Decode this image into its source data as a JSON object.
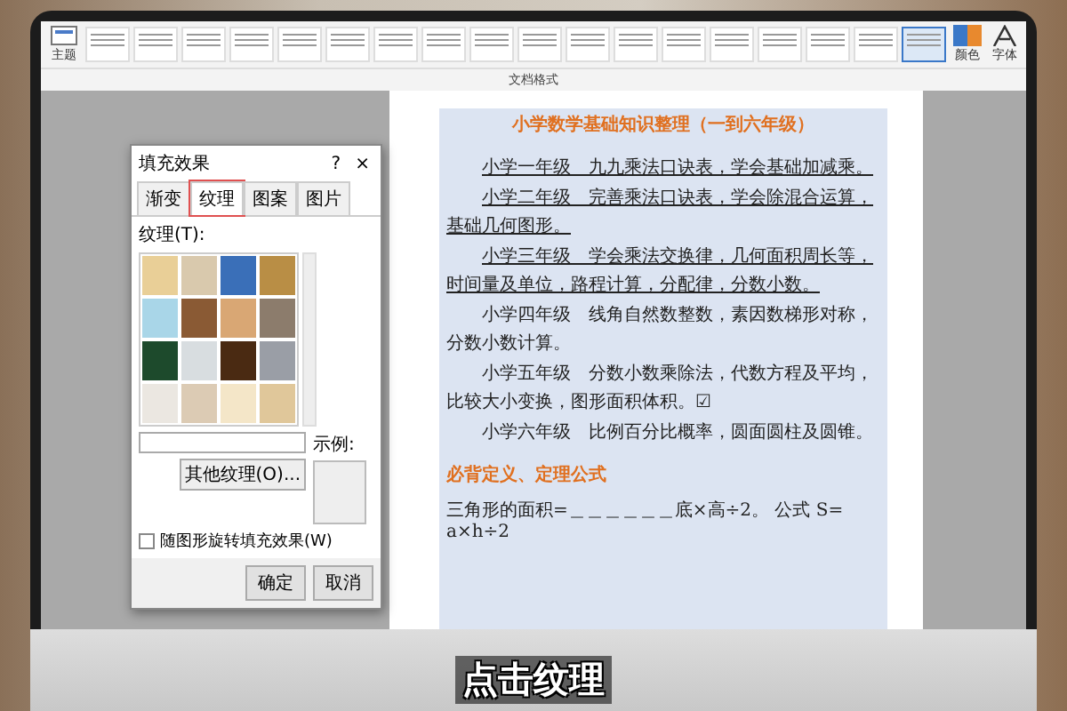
{
  "ribbon": {
    "theme_button": "主题",
    "styles": [
      {
        "selected": false
      },
      {
        "selected": false
      },
      {
        "selected": false
      },
      {
        "selected": false
      },
      {
        "selected": false
      },
      {
        "selected": false
      },
      {
        "selected": false
      },
      {
        "selected": false
      },
      {
        "selected": false
      },
      {
        "selected": false
      },
      {
        "selected": false
      },
      {
        "selected": false
      },
      {
        "selected": false
      },
      {
        "selected": false
      },
      {
        "selected": false
      },
      {
        "selected": false
      },
      {
        "selected": false
      },
      {
        "selected": true
      }
    ],
    "colors_button": "颜色",
    "fonts_button": "字体",
    "group_label": "文档格式"
  },
  "dialog": {
    "title": "填充效果",
    "help": "?",
    "close": "×",
    "tabs": [
      {
        "label": "渐变",
        "selected": false
      },
      {
        "label": "纹理",
        "selected": true
      },
      {
        "label": "图案",
        "selected": false
      },
      {
        "label": "图片",
        "selected": false
      }
    ],
    "texture_label": "纹理(T):",
    "textures": [
      {
        "color": "#e9cf97"
      },
      {
        "color": "#d9c9ad"
      },
      {
        "color": "#3a6fb8"
      },
      {
        "color": "#b98e45"
      },
      {
        "color": "#a9d6e8"
      },
      {
        "color": "#8a5a34"
      },
      {
        "color": "#d9a774"
      },
      {
        "color": "#8c7c6c"
      },
      {
        "color": "#1d4a2c"
      },
      {
        "color": "#d8dde0"
      },
      {
        "color": "#4a2a12"
      },
      {
        "color": "#9a9ea6"
      },
      {
        "color": "#ebe7e1"
      },
      {
        "color": "#dccbb4"
      },
      {
        "color": "#f4e6c8"
      },
      {
        "color": "#e0c79a"
      }
    ],
    "more_button": "其他纹理(O)...",
    "preview_label": "示例:",
    "rotate_option": {
      "label": "随图形旋转填充效果(W)",
      "checked": false
    },
    "buttons": [
      "确定",
      "取消"
    ]
  },
  "document": {
    "title": "小学数学基础知识整理（一到六年级）",
    "paragraphs": [
      {
        "text": "小学一年级　九九乘法口诀表，学会基础加减乘。",
        "underlined": true
      },
      {
        "text": "小学二年级　完善乘法口诀表，学会除混合运算，基础几何图形。",
        "underlined": true
      },
      {
        "text": "小学三年级　学会乘法交换律，几何面积周长等，时间量及单位，路程计算，分配律，分数小数。",
        "underlined": true
      },
      {
        "text": "小学四年级　线角自然数整数，素因数梯形对称，分数小数计算。",
        "underlined": false
      },
      {
        "text": "小学五年级　分数小数乘除法，代数方程及平均，比较大小变换，图形面积体积。☑",
        "underlined": false
      },
      {
        "text": "小学六年级　比例百分比概率，圆面圆柱及圆锥。",
        "underlined": false
      }
    ],
    "heading": "必背定义、定理公式",
    "formula": "三角形的面积=＿＿＿＿＿＿底×高÷2。 公式 S= a×h÷2"
  },
  "caption": "点击纹理"
}
